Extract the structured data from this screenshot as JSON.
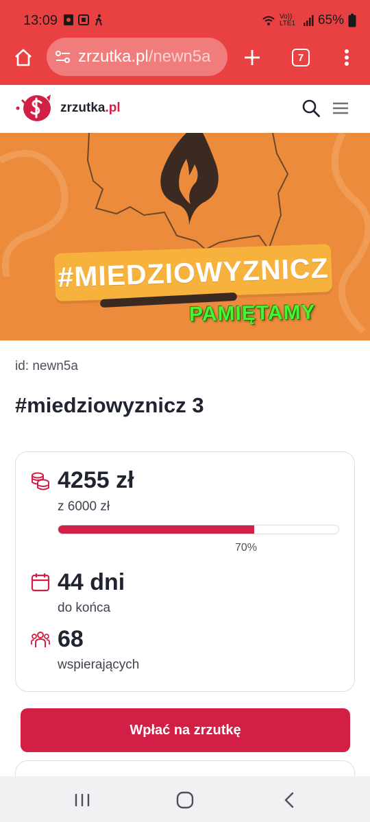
{
  "status_bar": {
    "time": "13:09",
    "network": "Vo)) LTE1",
    "battery": "65%"
  },
  "browser": {
    "url_host": "zrzutka.pl",
    "url_path": "/newn5a",
    "tab_count": "7"
  },
  "site": {
    "logo_name": "zrzutka",
    "logo_tld": ".pl"
  },
  "hero": {
    "hashtag": "#MIEDZIOWYZNICZ",
    "subtitle": "PAMIĘTAMY"
  },
  "fundraiser": {
    "id_label": "id: newn5a",
    "title": "#miedziowyznicz 3"
  },
  "stats": {
    "raised": "4255 zł",
    "goal": "z 6000 zł",
    "progress_percent": 70,
    "progress_label": "70%",
    "days": "44 dni",
    "days_label": "do końca",
    "supporters": "68",
    "supporters_label": "wspierających"
  },
  "cta": {
    "label": "Wpłać na zrzutkę"
  },
  "colors": {
    "browser_red": "#e94042",
    "brand_red": "#d21f45",
    "hero_orange": "#ec8b3b",
    "banner_yellow": "#f6b23d",
    "subtitle_green": "#4df033"
  },
  "icons": {
    "status": [
      "gallery-icon",
      "screen-record-icon",
      "walking-icon",
      "wifi-icon",
      "signal-icon",
      "battery-icon"
    ],
    "toolbar": [
      "home-icon",
      "site-settings-icon",
      "new-tab-icon",
      "tabs-icon",
      "more-icon"
    ],
    "header": [
      "piggy-bank-logo-icon",
      "search-icon",
      "menu-icon"
    ],
    "stats": [
      "coins-icon",
      "calendar-icon",
      "supporters-icon"
    ],
    "nav": [
      "recents-icon",
      "home-nav-icon",
      "back-icon"
    ]
  }
}
